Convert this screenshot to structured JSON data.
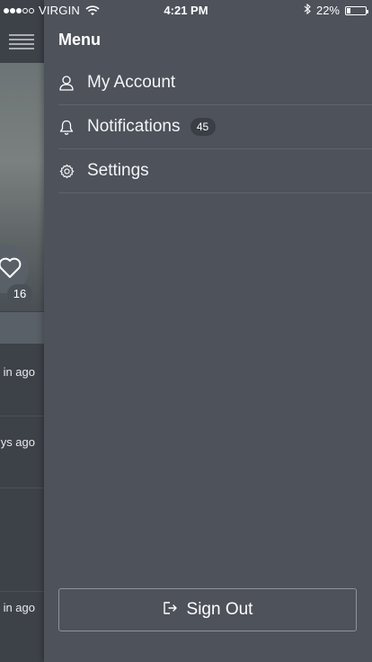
{
  "status_bar": {
    "carrier": "VIRGIN",
    "signal_dots_filled": 3,
    "signal_dots_total": 5,
    "time": "4:21 PM",
    "battery_percent": "22%",
    "battery_level": 0.22,
    "icons": [
      "wifi-icon",
      "bluetooth-icon",
      "battery-icon"
    ]
  },
  "background_feed": {
    "menu_icon": "hamburger-icon",
    "like_icon": "heart-icon",
    "like_count": "16",
    "timestamps": [
      "in ago",
      "ys ago",
      "in ago"
    ]
  },
  "menu": {
    "title": "Menu",
    "items": [
      {
        "label": "My Account",
        "icon": "user-icon"
      },
      {
        "label": "Notifications",
        "icon": "bell-icon",
        "badge": "45"
      },
      {
        "label": "Settings",
        "icon": "gear-icon"
      }
    ],
    "sign_out": {
      "label": "Sign Out",
      "icon": "sign-out-icon"
    }
  },
  "colors": {
    "drawer_bg": "#4d525b",
    "peek_bg": "#3d4249",
    "divider": "#5f646c",
    "badge_bg": "#3a3f46",
    "text": "#ffffff"
  }
}
